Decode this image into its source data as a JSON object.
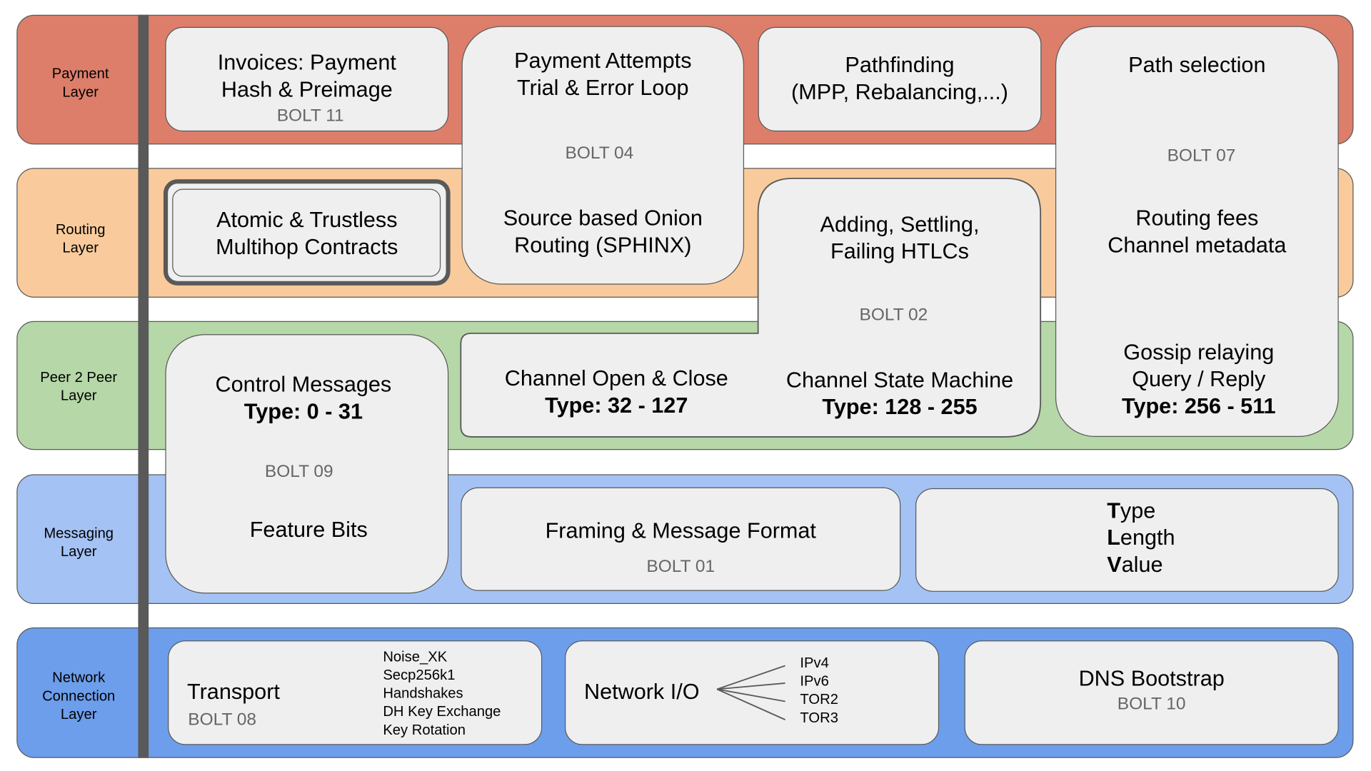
{
  "colors": {
    "payment": "#dd7e6b",
    "routing": "#f9cb9c",
    "p2p": "#b6d7a8",
    "messaging": "#a4c2f4",
    "network": "#6d9eeb",
    "box": "#efefef",
    "border": "#595959"
  },
  "layers": [
    "Payment Layer",
    "Routing Layer",
    "Peer 2 Peer Layer",
    "Messaging Layer",
    "Network Connection Layer"
  ],
  "layer_lines": [
    [
      "Payment",
      "Layer"
    ],
    [
      "Routing",
      "Layer"
    ],
    [
      "Peer 2 Peer",
      "Layer"
    ],
    [
      "Messaging",
      "Layer"
    ],
    [
      "Network",
      "Connection",
      "Layer"
    ]
  ],
  "boxes": {
    "invoices": {
      "lines": [
        "Invoices: Payment",
        "Hash & Preimage"
      ],
      "bolt": "BOLT 11"
    },
    "payment_attempts": {
      "lines": [
        "Payment Attempts",
        "Trial & Error Loop"
      ],
      "bolt": "BOLT 04",
      "lines2": [
        "Source based Onion",
        "Routing (SPHINX)"
      ]
    },
    "pathfinding": {
      "lines": [
        "Pathfinding",
        "(MPP, Rebalancing,...)"
      ]
    },
    "path_selection": {
      "lines": [
        "Path selection"
      ],
      "bolt": "BOLT 07",
      "lines2": [
        "Routing fees",
        "Channel metadata"
      ],
      "lines3": [
        "Gossip relaying",
        "Query / Reply"
      ],
      "type": "Type: 256 - 511"
    },
    "atomic": {
      "lines": [
        "Atomic & Trustless",
        "Multihop Contracts"
      ]
    },
    "htlcs": {
      "lines": [
        "Adding, Settling,",
        "Failing HTLCs"
      ],
      "bolt": "BOLT 02",
      "lines2": [
        "Channel State Machine"
      ],
      "type": "Type: 128 - 255"
    },
    "channel_open": {
      "lines": [
        "Channel Open & Close"
      ],
      "type": "Type: 32 - 127"
    },
    "control": {
      "lines": [
        "Control Messages"
      ],
      "type": "Type: 0 - 31",
      "bolt": "BOLT 09",
      "lines2": [
        "Feature Bits"
      ]
    },
    "framing": {
      "lines": [
        "Framing & Message Format"
      ],
      "bolt": "BOLT 01"
    },
    "tlv": {
      "initials": [
        "T",
        "L",
        "V"
      ],
      "rest": [
        "ype",
        "ength",
        "alue"
      ]
    },
    "transport": {
      "title": "Transport",
      "bolt": "BOLT 08",
      "items": [
        "Noise_XK",
        "Secp256k1",
        "Handshakes",
        "DH Key Exchange",
        "Key Rotation"
      ]
    },
    "network_io": {
      "title": "Network I/O",
      "items": [
        "IPv4",
        "IPv6",
        "TOR2",
        "TOR3"
      ]
    },
    "dns": {
      "title": "DNS Bootstrap",
      "bolt": "BOLT 10"
    }
  }
}
